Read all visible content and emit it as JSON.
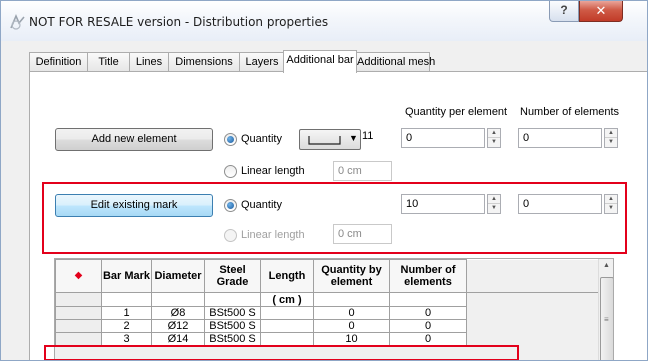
{
  "window": {
    "title": "NOT FOR RESALE version - Distribution properties",
    "help_label": "?",
    "close_label": "✕"
  },
  "tabs": [
    "Definition",
    "Title",
    "Lines",
    "Dimensions",
    "Layers",
    "Additional bar",
    "Additional mesh"
  ],
  "active_tab": "Additional bar",
  "form": {
    "header_qty_per_element": "Quantity per element",
    "header_num_elements": "Number of elements",
    "add_new_button": "Add new element",
    "edit_existing_button": "Edit existing mark",
    "quantity_label": "Quantity",
    "linear_length_label": "Linear length",
    "row1": {
      "bar_shape_value": "11",
      "qty_per_element": "0",
      "num_elements": "0",
      "linear_length": "0 cm"
    },
    "row2": {
      "qty_per_element": "10",
      "num_elements": "0",
      "linear_length": "0 cm"
    }
  },
  "grid": {
    "marker": "◆",
    "marker_color": "#e3001b",
    "columns": [
      "Bar Mark",
      "Diameter",
      "Steel Grade",
      "Length",
      "Quantity by element",
      "Number of elements"
    ],
    "units_row": [
      "",
      "",
      "",
      "( cm )",
      "",
      ""
    ],
    "rows": [
      [
        "1",
        "Ø8",
        "BSt500 S",
        "",
        "0",
        "0"
      ],
      [
        "2",
        "Ø12",
        "BSt500 S",
        "",
        "0",
        "0"
      ],
      [
        "3",
        "Ø14",
        "BSt500 S",
        "",
        "10",
        "0"
      ]
    ]
  },
  "colors": {
    "highlight": "#e3001b",
    "focus_button": "#bee6fd"
  }
}
